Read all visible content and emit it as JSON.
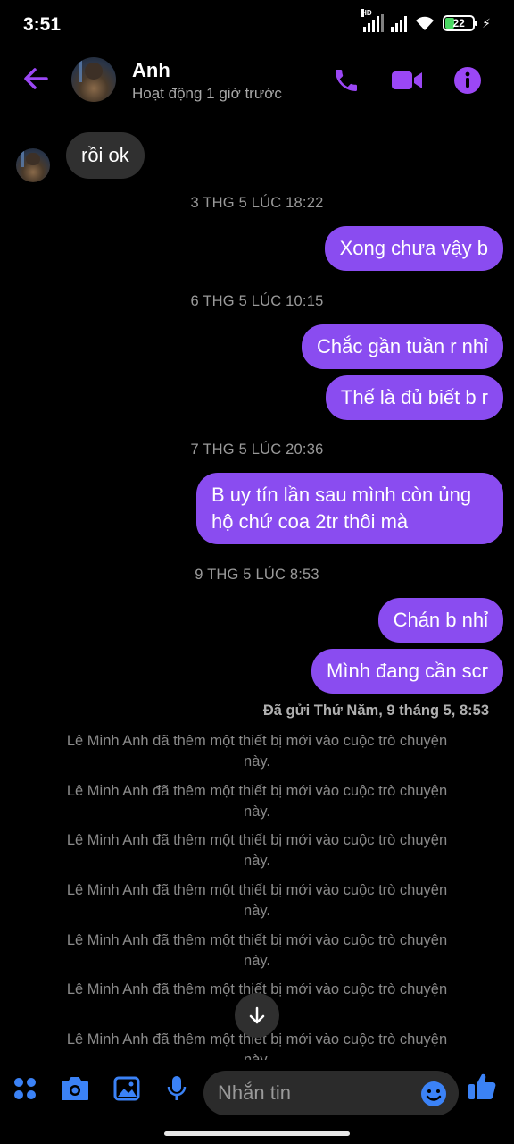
{
  "status_bar": {
    "time": "3:51",
    "hd_label": "HD",
    "battery": "22"
  },
  "header": {
    "contact_name": "Anh",
    "contact_status": "Hoạt động 1 giờ trước"
  },
  "colors": {
    "accent": "#9b47f5",
    "bubble_out": "#8a4cf0",
    "bubble_in": "#303030",
    "composer_icon": "#3b82f6"
  },
  "messages": {
    "incoming_1": "rồi ok",
    "ts_1": "3 THG 5 LÚC 18:22",
    "out_1": "Xong chưa vậy b",
    "ts_2": "6 THG 5 LÚC 10:15",
    "out_2": "Chắc gần tuần r nhỉ",
    "out_3": "Thế là đủ biết b r",
    "ts_3": "7 THG 5 LÚC 20:36",
    "out_4": "B uy tín lần sau mình còn ủng hộ chứ coa 2tr thôi mà",
    "ts_4": "9 THG 5 LÚC 8:53",
    "out_5": "Chán b nhỉ",
    "out_6": "Mình đang cần scr",
    "sent_info": "Đã gửi Thứ Năm, 9 tháng 5, 8:53"
  },
  "system_notices": [
    "Lê Minh Anh đã thêm một thiết bị mới vào cuộc trò chuyện này.",
    "Lê Minh Anh đã thêm một thiết bị mới vào cuộc trò chuyện này.",
    "Lê Minh Anh đã thêm một thiết bị mới vào cuộc trò chuyện này.",
    "Lê Minh Anh đã thêm một thiết bị mới vào cuộc trò chuyện này.",
    "Lê Minh Anh đã thêm một thiết bị mới vào cuộc trò chuyện này.",
    "Lê Minh Anh đã thêm một thiết bị mới vào cuộc trò chuyện này.",
    "Lê Minh Anh đã thêm một thiết bị mới vào cuộc trò chuyện này."
  ],
  "composer": {
    "placeholder": "Nhắn tin"
  },
  "icons": {
    "back": "arrow-left-icon",
    "call": "phone-icon",
    "video": "video-camera-icon",
    "info": "info-icon",
    "apps": "grid-dots-icon",
    "camera": "camera-icon",
    "gallery": "image-icon",
    "mic": "microphone-icon",
    "emoji": "emoji-icon",
    "like": "thumbs-up-icon",
    "scroll": "arrow-down-icon"
  }
}
